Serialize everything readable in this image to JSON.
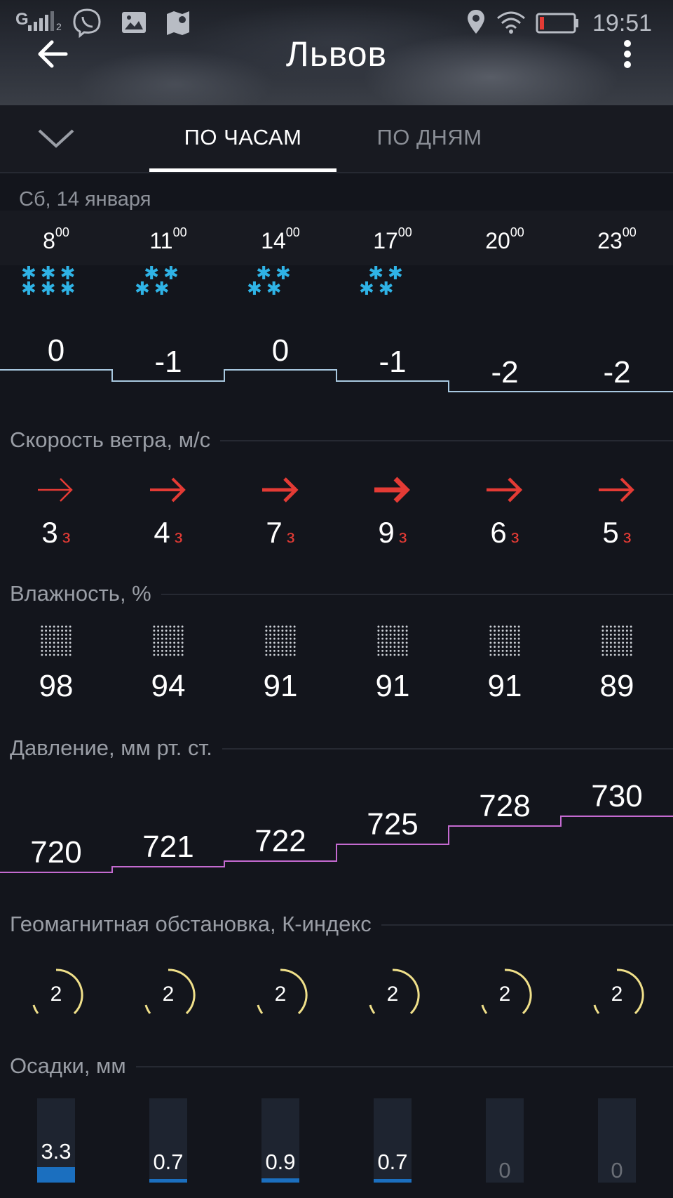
{
  "status_bar": {
    "network": "G",
    "sim": "2",
    "time": "19:51",
    "battery_color": "#e43b35"
  },
  "header": {
    "title": "Львов",
    "back_icon": "arrow-left-icon",
    "menu_icon": "more-vert-icon"
  },
  "tabs": [
    {
      "label": "ПО ЧАСАМ",
      "active": true
    },
    {
      "label": "ПО ДНЯМ",
      "active": false
    }
  ],
  "collapse_icon": "chevron-down-icon",
  "date_label": "Сб, 14 января",
  "hours": [
    {
      "h": "8",
      "m": "00"
    },
    {
      "h": "11",
      "m": "00"
    },
    {
      "h": "14",
      "m": "00"
    },
    {
      "h": "17",
      "m": "00"
    },
    {
      "h": "20",
      "m": "00"
    },
    {
      "h": "23",
      "m": "00"
    }
  ],
  "temperatures": [
    "0",
    "-1",
    "0",
    "-1",
    "-2",
    "-2"
  ],
  "snow_icons": [
    "heavy-snow-icon",
    "snow-icon",
    "snow-icon",
    "snow-icon",
    "",
    ""
  ],
  "sections": {
    "wind": "Скорость ветра, м/с",
    "humidity": "Влажность, %",
    "pressure": "Давление, мм рт. ст.",
    "geomagnetic": "Геомагнитная обстановка, К-индекс",
    "precipitation": "Осадки, мм"
  },
  "wind": [
    {
      "speed": "3",
      "dir": "з"
    },
    {
      "speed": "4",
      "dir": "з"
    },
    {
      "speed": "7",
      "dir": "з"
    },
    {
      "speed": "9",
      "dir": "з"
    },
    {
      "speed": "6",
      "dir": "з"
    },
    {
      "speed": "5",
      "dir": "з"
    }
  ],
  "humidity": [
    "98",
    "94",
    "91",
    "91",
    "91",
    "89"
  ],
  "pressure": [
    "720",
    "721",
    "722",
    "725",
    "728",
    "730"
  ],
  "geomagnetic": [
    "2",
    "2",
    "2",
    "2",
    "2",
    "2"
  ],
  "precipitation": [
    "3.3",
    "0.7",
    "0.9",
    "0.7",
    "0",
    "0"
  ],
  "colors": {
    "temp_line": "#a8c8e0",
    "pressure_line": "#c46ad0",
    "wind_arrow": "#e43b35",
    "geo_arc": "#f0e08a",
    "snow": "#2fb3e6",
    "precip": "#1b6fbf"
  }
}
